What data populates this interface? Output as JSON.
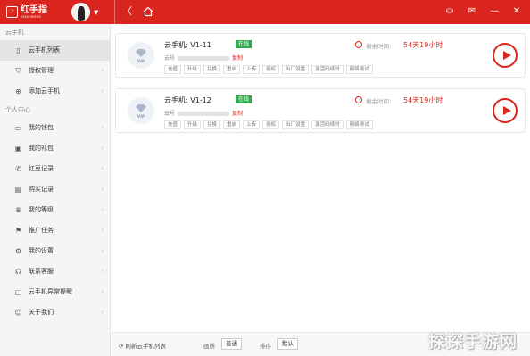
{
  "header": {
    "logo_text": "红手指",
    "logo_sub": "REDFINGER",
    "back_glyph": "〈",
    "icons": [
      "gift-icon",
      "mail-icon",
      "minimize-icon",
      "close-icon"
    ]
  },
  "sidebar": {
    "section1": "云手机",
    "items1": [
      {
        "label": "云手机列表",
        "icon": "phone-icon"
      },
      {
        "label": "授权管理",
        "icon": "shield-icon"
      },
      {
        "label": "添加云手机",
        "icon": "plus-circle-icon"
      }
    ],
    "section2": "个人中心",
    "items2": [
      {
        "label": "我的钱包",
        "icon": "wallet-icon"
      },
      {
        "label": "我的礼包",
        "icon": "gift-box-icon"
      },
      {
        "label": "红豆记录",
        "icon": "phone-record-icon"
      },
      {
        "label": "购买记录",
        "icon": "doc-icon"
      },
      {
        "label": "我的等级",
        "icon": "crown-icon"
      },
      {
        "label": "推广任务",
        "icon": "flag-icon"
      },
      {
        "label": "我的设置",
        "icon": "gear-icon"
      },
      {
        "label": "联系客服",
        "icon": "headset-icon"
      },
      {
        "label": "云手机异常提醒",
        "icon": "alert-icon"
      },
      {
        "label": "关于我们",
        "icon": "smile-icon"
      }
    ]
  },
  "devices": [
    {
      "name": "云手机: V1-11",
      "status": "在线",
      "id_label": "云号",
      "copy": "复制",
      "remain_label": "剩余时间:",
      "remain": "54天19小时"
    },
    {
      "name": "云手机: V1-12",
      "status": "在线",
      "id_label": "云号",
      "copy": "复制",
      "remain_label": "剩余时间:",
      "remain": "54天19小时"
    }
  ],
  "actions": [
    "充值",
    "升级",
    "兑换",
    "重启",
    "上传",
    "授权",
    "出厂设置",
    "激活码续时",
    "网络测试"
  ],
  "vip_label": "VIP",
  "footer": {
    "refresh": "刷新云手机列表",
    "quality_label": "画质",
    "quality_value": "普通",
    "sort_label": "排序",
    "sort_value": "默认"
  },
  "watermark": "探探手游网",
  "colors": {
    "accent": "#d9251d",
    "online": "#2fab4b"
  }
}
